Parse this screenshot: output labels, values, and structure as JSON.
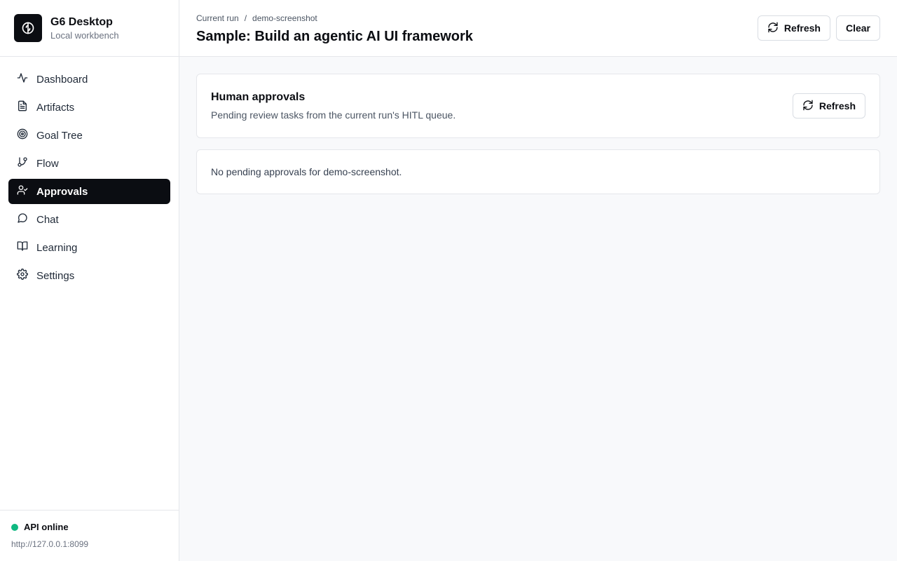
{
  "brand": {
    "name": "G6 Desktop",
    "subtitle": "Local workbench",
    "logo_icon": "brain-icon"
  },
  "sidebar": {
    "items": [
      {
        "label": "Dashboard",
        "icon": "activity-icon",
        "active": false
      },
      {
        "label": "Artifacts",
        "icon": "file-text-icon",
        "active": false
      },
      {
        "label": "Goal Tree",
        "icon": "target-icon",
        "active": false
      },
      {
        "label": "Flow",
        "icon": "git-branch-icon",
        "active": false
      },
      {
        "label": "Approvals",
        "icon": "user-check-icon",
        "active": true
      },
      {
        "label": "Chat",
        "icon": "message-circle-icon",
        "active": false
      },
      {
        "label": "Learning",
        "icon": "book-open-icon",
        "active": false
      },
      {
        "label": "Settings",
        "icon": "gear-icon",
        "active": false
      }
    ],
    "status": {
      "label": "API online",
      "url": "http://127.0.0.1:8099",
      "color": "#10b981"
    }
  },
  "header": {
    "breadcrumb": {
      "root": "Current run",
      "separator": "/",
      "current": "demo-screenshot"
    },
    "title": "Sample: Build an agentic AI UI framework",
    "refresh_label": "Refresh",
    "clear_label": "Clear"
  },
  "approvals": {
    "title": "Human approvals",
    "description": "Pending review tasks from the current run's HITL queue.",
    "refresh_label": "Refresh",
    "empty_message": "No pending approvals for demo-screenshot."
  },
  "colors": {
    "accent": "#0b0d12",
    "background": "#f8f9fb",
    "border": "#e5e7eb",
    "online": "#10b981"
  }
}
